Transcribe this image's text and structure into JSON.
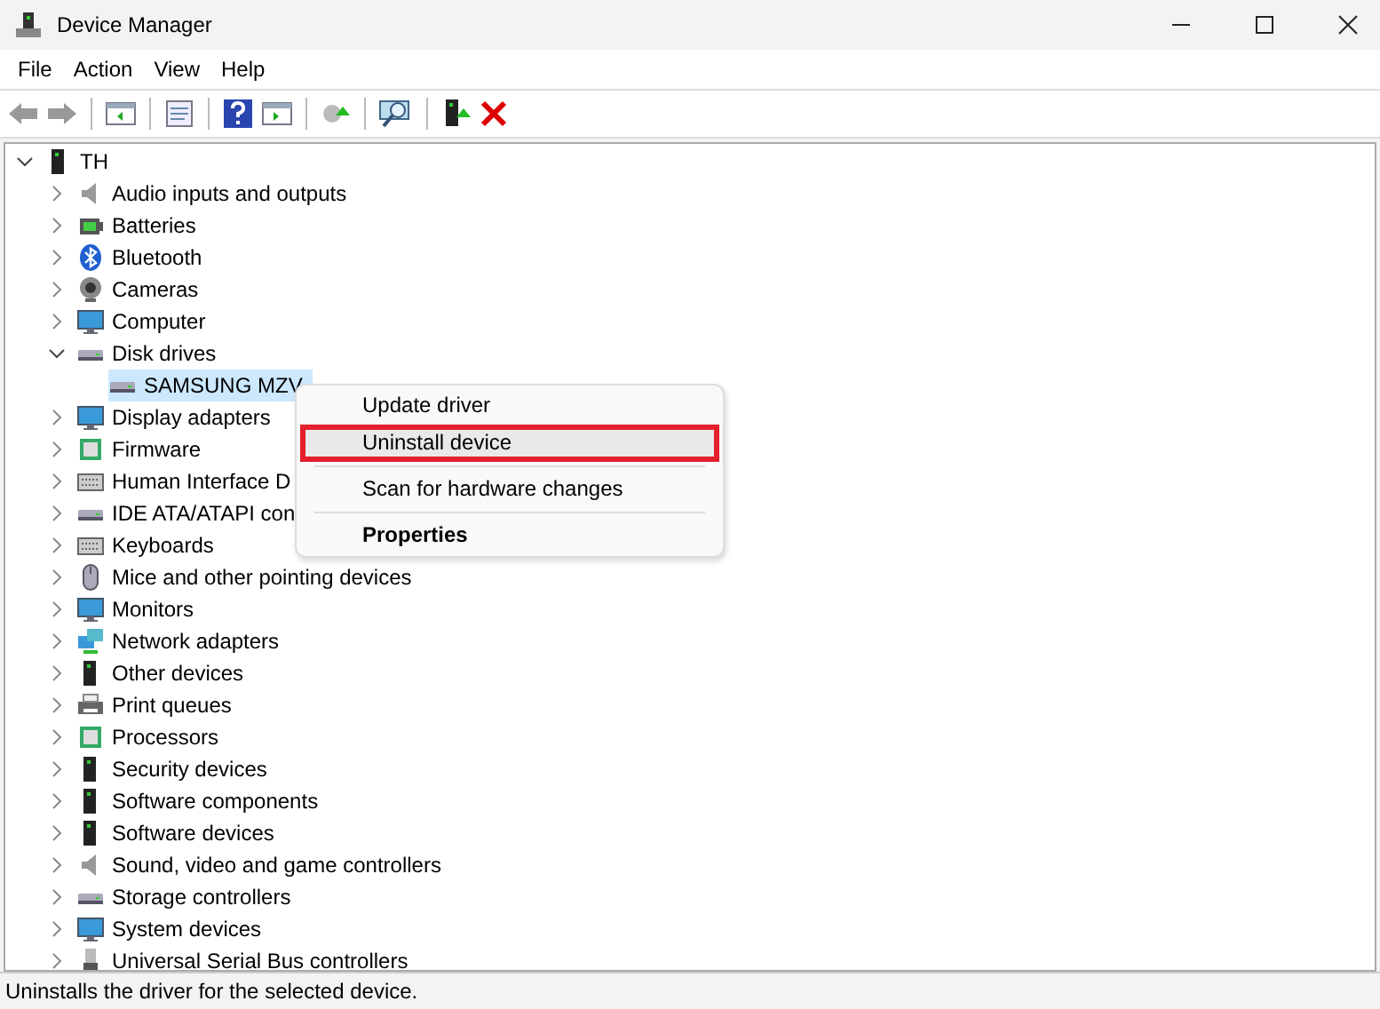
{
  "window": {
    "title": "Device Manager"
  },
  "menu_bar": [
    "File",
    "Action",
    "View",
    "Help"
  ],
  "tree": {
    "label": "TH",
    "expanded": true,
    "selected": false,
    "children": [
      {
        "label": "Audio inputs and outputs",
        "expanded": false,
        "selected": false
      },
      {
        "label": "Batteries",
        "expanded": false,
        "selected": false
      },
      {
        "label": "Bluetooth",
        "expanded": false,
        "selected": false
      },
      {
        "label": "Cameras",
        "expanded": false,
        "selected": false
      },
      {
        "label": "Computer",
        "expanded": false,
        "selected": false
      },
      {
        "label": "Disk drives",
        "expanded": true,
        "selected": false,
        "children": [
          {
            "label": "SAMSUNG MZV",
            "selected": true
          }
        ]
      },
      {
        "label": "Display adapters",
        "expanded": false,
        "selected": false
      },
      {
        "label": "Firmware",
        "expanded": false,
        "selected": false
      },
      {
        "label": "Human Interface D",
        "expanded": false,
        "selected": false
      },
      {
        "label": "IDE ATA/ATAPI con",
        "expanded": false,
        "selected": false
      },
      {
        "label": "Keyboards",
        "expanded": false,
        "selected": false
      },
      {
        "label": "Mice and other pointing devices",
        "expanded": false,
        "selected": false
      },
      {
        "label": "Monitors",
        "expanded": false,
        "selected": false
      },
      {
        "label": "Network adapters",
        "expanded": false,
        "selected": false
      },
      {
        "label": "Other devices",
        "expanded": false,
        "selected": false
      },
      {
        "label": "Print queues",
        "expanded": false,
        "selected": false
      },
      {
        "label": "Processors",
        "expanded": false,
        "selected": false
      },
      {
        "label": "Security devices",
        "expanded": false,
        "selected": false
      },
      {
        "label": "Software components",
        "expanded": false,
        "selected": false
      },
      {
        "label": "Software devices",
        "expanded": false,
        "selected": false
      },
      {
        "label": "Sound, video and game controllers",
        "expanded": false,
        "selected": false
      },
      {
        "label": "Storage controllers",
        "expanded": false,
        "selected": false
      },
      {
        "label": "System devices",
        "expanded": false,
        "selected": false
      },
      {
        "label": "Universal Serial Bus controllers",
        "expanded": false,
        "selected": false
      }
    ]
  },
  "context_menu": [
    {
      "kind": "item",
      "label": "Update driver",
      "highlighted": false,
      "outlined": false,
      "default": false
    },
    {
      "kind": "item",
      "label": "Uninstall device",
      "highlighted": true,
      "outlined": true,
      "default": false
    },
    {
      "kind": "separator"
    },
    {
      "kind": "item",
      "label": "Scan for hardware changes",
      "highlighted": false,
      "outlined": false,
      "default": false
    },
    {
      "kind": "separator"
    },
    {
      "kind": "item",
      "label": "Properties",
      "highlighted": false,
      "outlined": false,
      "default": true
    }
  ],
  "status_bar": "Uninstalls the driver for the selected device."
}
